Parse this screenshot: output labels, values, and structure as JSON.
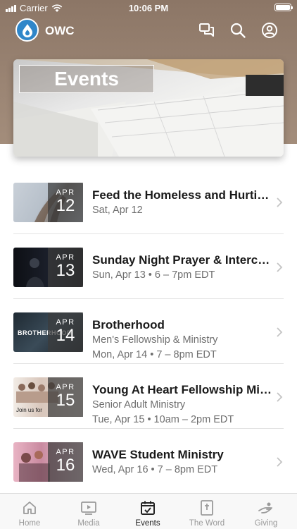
{
  "status_bar": {
    "carrier": "Carrier",
    "time": "10:06 PM"
  },
  "header": {
    "app_name": "OWC",
    "icons": [
      "chat-icon",
      "search-icon",
      "profile-icon"
    ]
  },
  "banner": {
    "title": "Events"
  },
  "events": [
    {
      "month": "APR",
      "day": "12",
      "title": "Feed the Homeless and Hurtin...",
      "lines": [
        "Sat, Apr 12"
      ]
    },
    {
      "month": "APR",
      "day": "13",
      "title": "Sunday Night Prayer & Interce...",
      "lines": [
        "Sun, Apr 13 • 6 – 7pm EDT"
      ]
    },
    {
      "month": "APR",
      "day": "14",
      "title": "Brotherhood",
      "lines": [
        "Men's Fellowship & Ministry",
        "Mon, Apr 14 • 7 – 8pm EDT"
      ],
      "thumb_text": "BROTHERHOOD"
    },
    {
      "month": "APR",
      "day": "15",
      "title": "Young At Heart Fellowship Min...",
      "lines": [
        "Senior Adult Ministry",
        "Tue, Apr 15 • 10am – 2pm EDT"
      ],
      "thumb_text": "Join us for"
    },
    {
      "month": "APR",
      "day": "16",
      "title": "WAVE Student Ministry",
      "lines": [
        "Wed, Apr 16 • 7 – 8pm EDT"
      ]
    }
  ],
  "tabs": [
    {
      "label": "Home",
      "icon": "home-icon",
      "active": false
    },
    {
      "label": "Media",
      "icon": "media-icon",
      "active": false
    },
    {
      "label": "Events",
      "icon": "calendar-icon",
      "active": true
    },
    {
      "label": "The Word",
      "icon": "bible-icon",
      "active": false
    },
    {
      "label": "Giving",
      "icon": "giving-hand-icon",
      "active": false
    }
  ],
  "colors": {
    "header_bg": "#8c7666",
    "accent_logo": "#2f86c9"
  }
}
